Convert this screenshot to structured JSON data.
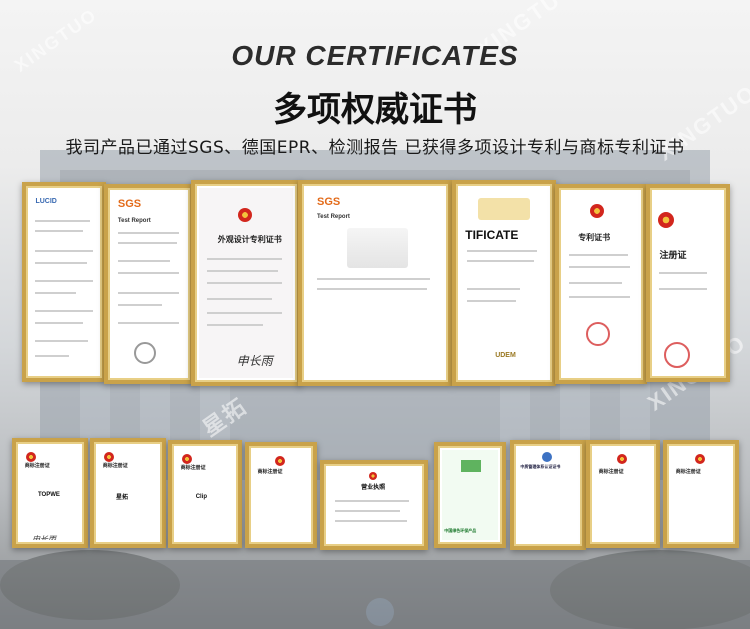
{
  "header": {
    "title_en": "OUR CERTIFICATES",
    "title_cn": "多项权威证书",
    "subtitle": "我司产品已通过SGS、德国EPR、检测报告 已获得多项设计专利与商标专利证书"
  },
  "watermark": {
    "text_en": "XINGTUO",
    "text_cn": "星拓"
  },
  "certificates_top": [
    {
      "id": "cert-report-1",
      "heading": "LUCID"
    },
    {
      "id": "cert-sgs-1",
      "heading": "SGS",
      "sub": "Test Report"
    },
    {
      "id": "cert-design-patent-1",
      "heading": "外观设计专利证书"
    },
    {
      "id": "cert-sgs-2",
      "heading": "SGS",
      "sub": "Test Report"
    },
    {
      "id": "cert-ce",
      "heading": "TIFICATE",
      "sub": "UDEM"
    },
    {
      "id": "cert-design-patent-2",
      "heading": "专利证书"
    },
    {
      "id": "cert-trademark-1",
      "heading": "注册证"
    }
  ],
  "certificates_bottom": [
    {
      "id": "tm-1",
      "heading": "商标注册证",
      "mark": "TOPWE"
    },
    {
      "id": "tm-2",
      "heading": "商标注册证",
      "mark": "星拓"
    },
    {
      "id": "tm-3",
      "heading": "商标注册证",
      "mark": "Clip"
    },
    {
      "id": "tm-4",
      "heading": "商标注册证",
      "mark": ""
    },
    {
      "id": "business-license",
      "heading": "营业执照"
    },
    {
      "id": "green-product",
      "heading": "中国绿色环保产品"
    },
    {
      "id": "quality-cert",
      "heading": "中质管理体系认证证书"
    },
    {
      "id": "tm-5",
      "heading": "商标注册证",
      "mark": ""
    },
    {
      "id": "tm-6",
      "heading": "商标注册证",
      "mark": ""
    }
  ],
  "colors": {
    "frame_gold": "#c9a24a",
    "emblem_red": "#d2261d",
    "sgs_orange": "#e36b1a"
  }
}
